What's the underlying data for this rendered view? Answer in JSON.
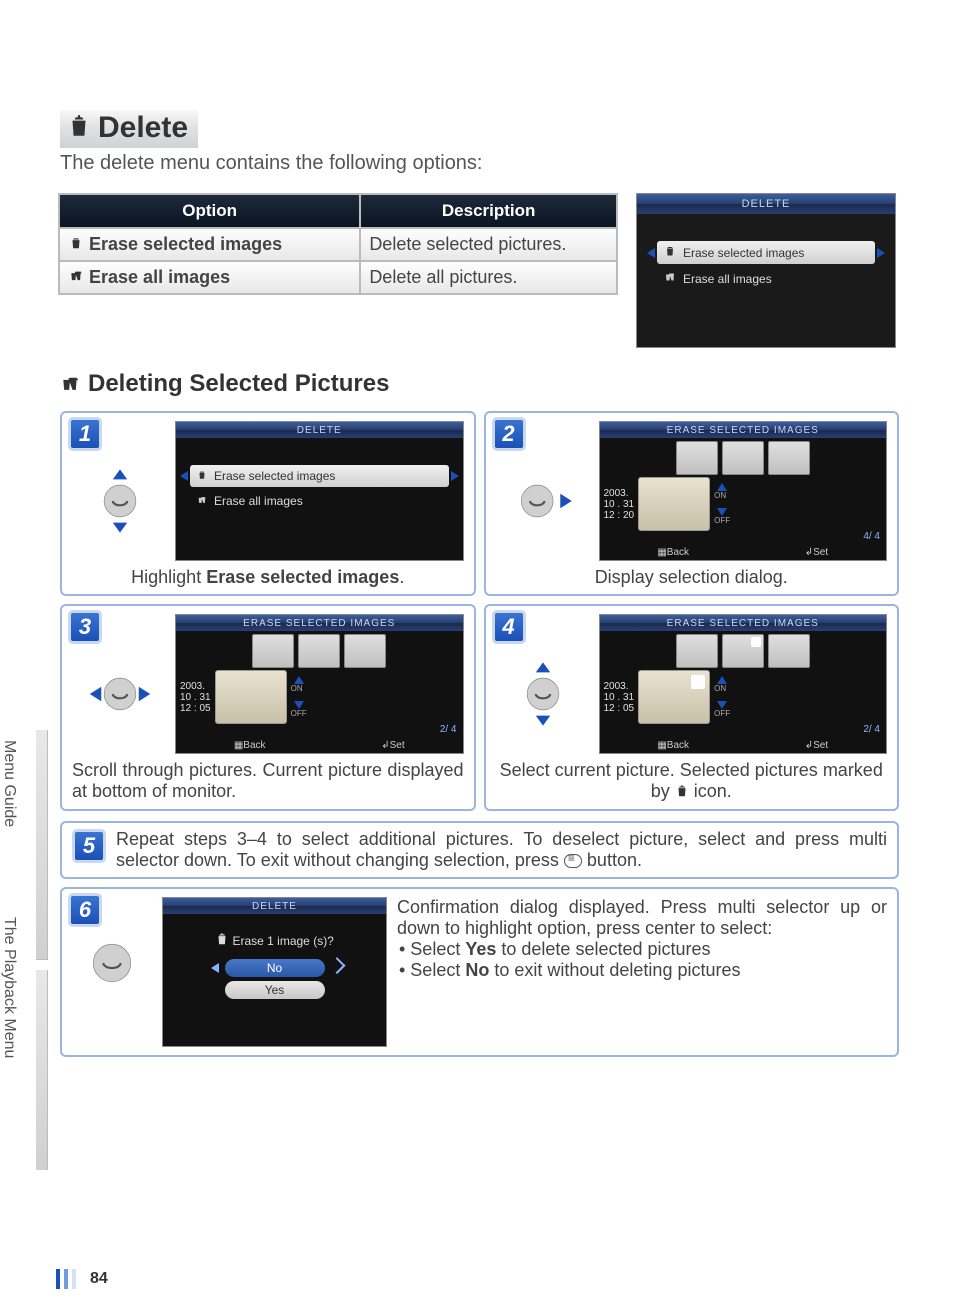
{
  "page": {
    "title": "Delete",
    "intro": "The delete menu contains the following options:",
    "page_number": "84"
  },
  "side_tabs": {
    "tab1": "Menu Guide",
    "tab2": "The Playback Menu"
  },
  "opt_table": {
    "head_option": "Option",
    "head_desc": "Description",
    "row1_opt": "Erase selected images",
    "row1_desc": "Delete selected pictures.",
    "row2_opt": "Erase all images",
    "row2_desc": "Delete all pictures."
  },
  "lcd_top": {
    "title": "DELETE",
    "item1": "Erase selected images",
    "item2": "Erase all images"
  },
  "section2": "Deleting Selected Pictures",
  "step1": {
    "num": "1",
    "lcd_title": "DELETE",
    "item1": "Erase selected images",
    "item2": "Erase all images",
    "caption_pre": "Highlight ",
    "caption_strong": "Erase selected images",
    "caption_post": "."
  },
  "step2": {
    "num": "2",
    "lcd_title": "ERASE SELECTED IMAGES",
    "date1": "2003.",
    "date2": "10 . 31",
    "date3": "12 : 20",
    "on": "ON",
    "off": "OFF",
    "counter": "4/     4",
    "back": "Back",
    "set": "Set",
    "caption": "Display selection dialog."
  },
  "step3": {
    "num": "3",
    "lcd_title": "ERASE SELECTED IMAGES",
    "date1": "2003.",
    "date2": "10 . 31",
    "date3": "12 : 05",
    "on": "ON",
    "off": "OFF",
    "counter": "2/     4",
    "back": "Back",
    "set": "Set",
    "caption": "Scroll through pictures.  Current picture displayed at bottom of monitor."
  },
  "step4": {
    "num": "4",
    "lcd_title": "ERASE SELECTED IMAGES",
    "date1": "2003.",
    "date2": "10 . 31",
    "date3": "12 : 05",
    "on": "ON",
    "off": "OFF",
    "counter": "2/     4",
    "back": "Back",
    "set": "Set",
    "caption_pre": "Select current picture.  Selected pictures marked by ",
    "caption_post": " icon."
  },
  "step5": {
    "num": "5",
    "text_pre": "Repeat steps 3–4 to select additional pictures.  To deselect picture, select and press multi selector down.  To exit without changing selection, press ",
    "text_post": " button."
  },
  "step6": {
    "num": "6",
    "lcd_title": "DELETE",
    "confirm": "Erase 1 image (s)?",
    "no": "No",
    "yes": "Yes",
    "text1": "Confirmation dialog displayed.  Press multi selector up or down to highlight option, press center to select:",
    "b1_pre": "• Select ",
    "b1_strong": "Yes",
    "b1_post": " to delete selected pictures",
    "b2_pre": "• Select ",
    "b2_strong": "No",
    "b2_post": " to exit without deleting pictures"
  }
}
